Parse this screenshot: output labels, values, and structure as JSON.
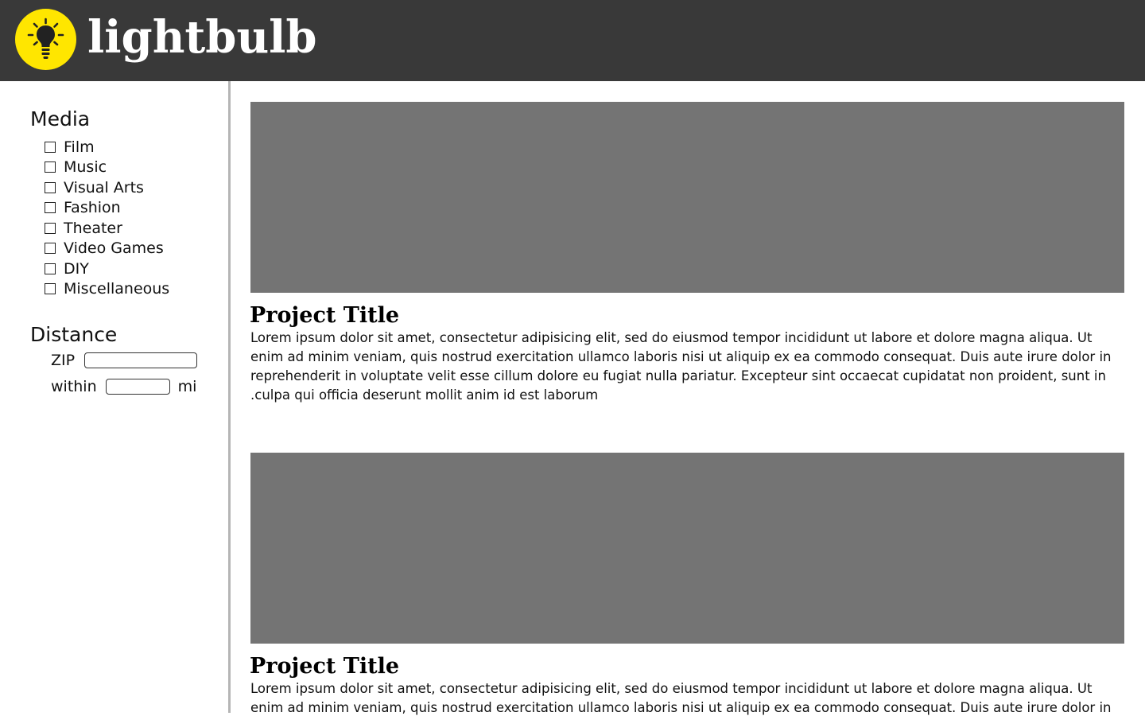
{
  "header": {
    "logo_text": "lightbulb",
    "logo_icon": "lightbulb-icon",
    "background": "#393939",
    "accent": "#ffe600"
  },
  "sidebar": {
    "media_heading": "Media",
    "media_items": [
      {
        "label": "Film",
        "checked": false
      },
      {
        "label": "Music",
        "checked": false
      },
      {
        "label": "Visual Arts",
        "checked": false
      },
      {
        "label": "Fashion",
        "checked": false
      },
      {
        "label": "Theater",
        "checked": false
      },
      {
        "label": "Video Games",
        "checked": false
      },
      {
        "label": "DIY",
        "checked": false
      },
      {
        "label": "Miscellaneous",
        "checked": false
      }
    ],
    "distance_heading": "Distance",
    "zip_label": "ZIP",
    "zip_value": "",
    "within_label": "within",
    "within_value": "",
    "unit_label": "mi"
  },
  "projects": [
    {
      "title": "Project Title",
      "description": "Lorem ipsum dolor sit amet, consectetur adipisicing elit, sed do eiusmod tempor incididunt ut labore et dolore magna aliqua. Ut enim ad minim veniam, quis nostrud exercitation ullamco laboris nisi ut aliquip ex ea commodo consequat. Duis aute irure dolor in reprehenderit in voluptate velit esse cillum dolore eu fugiat nulla pariatur. Excepteur sint occaecat cupidatat non proident, sunt in .culpa qui officia deserunt mollit anim id est laborum"
    },
    {
      "title": "Project Title",
      "description": "Lorem ipsum dolor sit amet, consectetur adipisicing elit, sed do eiusmod tempor incididunt ut labore et dolore magna aliqua. Ut enim ad minim veniam, quis nostrud exercitation ullamco laboris nisi ut aliquip ex ea commodo consequat. Duis aute irure dolor in"
    }
  ]
}
